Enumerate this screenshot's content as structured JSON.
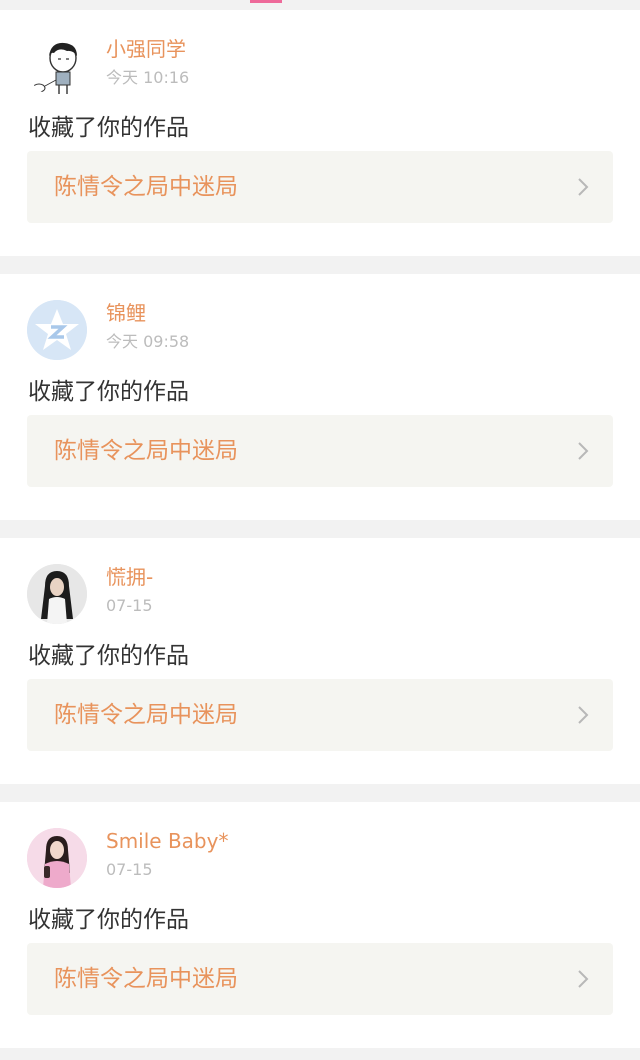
{
  "accent_color": "#e8935c",
  "notifications": [
    {
      "username": "小强同学",
      "time": "今天 10:16",
      "action": "收藏了你的作品",
      "work_title": "陈情令之局中迷局",
      "avatar": "cartoon-boy-avatar"
    },
    {
      "username": "锦鲤",
      "time": "今天 09:58",
      "action": "收藏了你的作品",
      "work_title": "陈情令之局中迷局",
      "avatar": "default-star-avatar"
    },
    {
      "username": "慌拥-",
      "time": "07-15",
      "action": "收藏了你的作品",
      "work_title": "陈情令之局中迷局",
      "avatar": "long-hair-girl-avatar"
    },
    {
      "username": "Smile Baby*",
      "time": "07-15",
      "action": "收藏了你的作品",
      "work_title": "陈情令之局中迷局",
      "avatar": "pink-girl-avatar"
    }
  ]
}
